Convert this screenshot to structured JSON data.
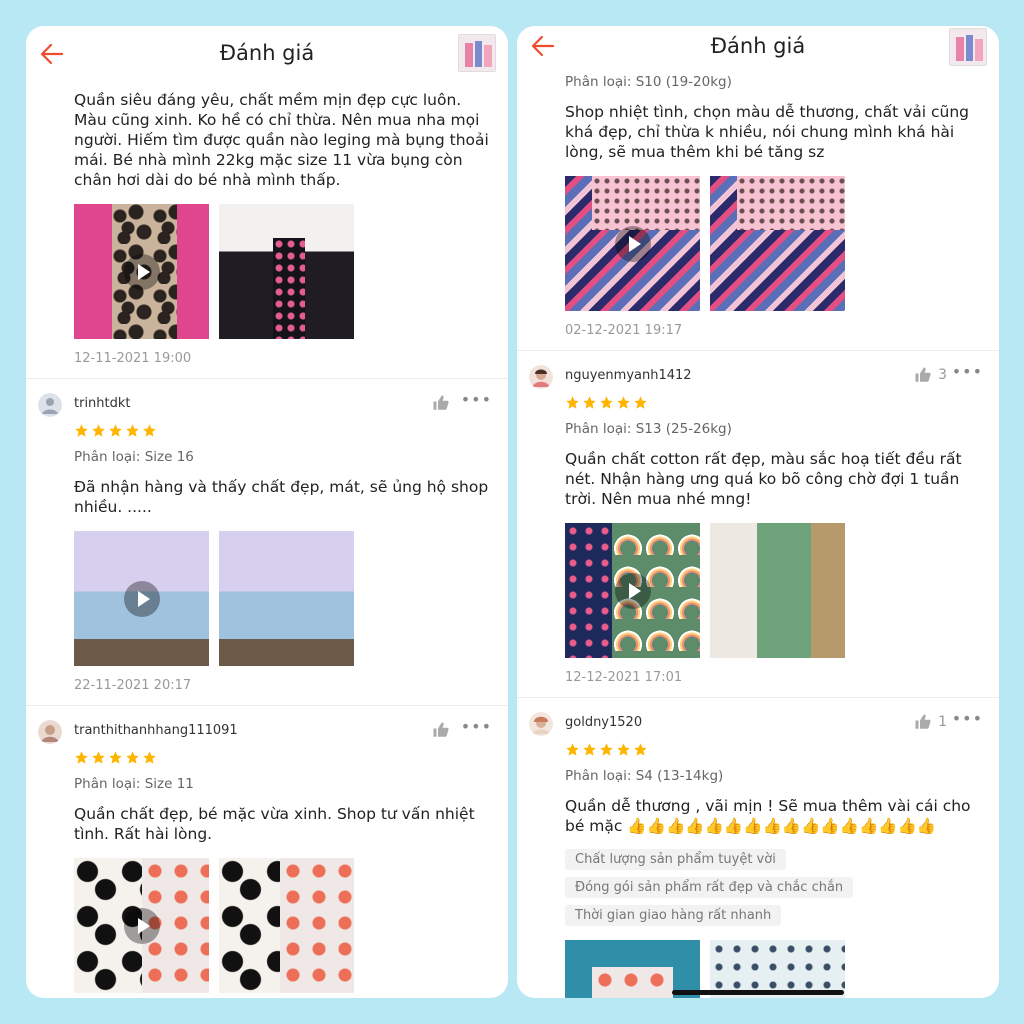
{
  "colors": {
    "background": "#b9e8f5",
    "accent": "#ee4d2d",
    "star": "#ffb500"
  },
  "left_panel": {
    "header": {
      "title": "Đánh giá",
      "back_icon": "back-arrow-icon"
    },
    "first_review": {
      "text": "Quần siêu đáng yêu, chất mềm mịn đẹp cực luôn. Màu cũng xinh. Ko hề có chỉ thừa. Nên mua nha mọi người. Hiếm tìm được quần nào leging mà bụng thoải mái. Bé nhà mình 22kg mặc size 11 vừa bụng còn chân hơi dài do bé nhà mình thấp.",
      "date": "12-11-2021 19:00"
    },
    "reviews": [
      {
        "username": "trinhtdkt",
        "stars": 5,
        "variant": "Phân loại: Size 16",
        "text": "Đã nhận hàng và thấy chất đẹp, mát, sẽ ủng hộ shop nhiều. .....",
        "date": "22-11-2021 20:17",
        "like_count": ""
      },
      {
        "username": "tranthithanhhang111091",
        "stars": 5,
        "variant": "Phân loại: Size 11",
        "text": "Quần chất đẹp, bé mặc vừa xinh. Shop tư vấn nhiệt tình. Rất hài lòng.",
        "date": "",
        "like_count": ""
      }
    ]
  },
  "right_panel": {
    "header": {
      "title": "Đánh giá",
      "back_icon": "back-arrow-icon"
    },
    "first_review": {
      "variant": "Phân loại: S10 (19-20kg)",
      "text": "Shop nhiệt tình, chọn màu dễ thương, chất vải cũng khá đẹp, chỉ thừa k nhiều, nói chung mình khá hài lòng, sẽ mua thêm khi bé tăng sz",
      "date": "02-12-2021 19:17"
    },
    "reviews": [
      {
        "username": "nguyenmyanh1412",
        "stars": 5,
        "variant": "Phân loại: S13 (25-26kg)",
        "text": "Quần chất cotton rất đẹp, màu sắc hoạ tiết đều rất nét. Nhận hàng ưng quá ko bõ công chờ đợi 1 tuần trời. Nên mua nhé mng!",
        "date": "12-12-2021 17:01",
        "like_count": "3"
      },
      {
        "username": "goldny1520",
        "stars": 5,
        "variant": "Phân loại: S4 (13-14kg)",
        "text": "Quần dễ thương , vãi mịn ! Sẽ mua thêm vài cái cho bé mặc 👍👍👍👍👍👍👍👍👍👍👍👍👍👍👍👍",
        "tags": [
          "Chất lượng sản phẩm tuyệt vời",
          "Đóng gói sản phẩm rất đẹp và chắc chắn",
          "Thời gian giao hàng rất nhanh"
        ],
        "date": "",
        "like_count": "1"
      }
    ]
  }
}
